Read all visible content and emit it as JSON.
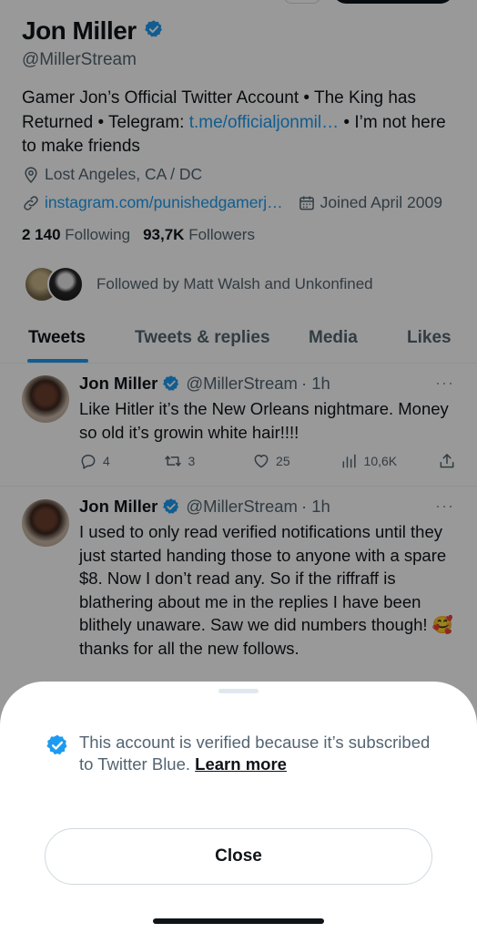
{
  "profile": {
    "name": "Jon Miller",
    "handle": "@MillerStream",
    "bio_part1": "Gamer Jon’s Official Twitter Account • The King has Returned • Telegram: ",
    "bio_link": "t.me/officialjonmil…",
    "bio_part2": " • I’m not here to make friends",
    "location": "Lost Angeles, CA / DC",
    "website": "instagram.com/punishedgamerj…",
    "joined": "Joined April 2009",
    "following_count": "2 140",
    "following_label": "Following",
    "followers_count": "93,7K",
    "followers_label": "Followers",
    "followed_by": "Followed by Matt Walsh and Unkonfined"
  },
  "tabs": [
    {
      "label": "Tweets",
      "active": true
    },
    {
      "label": "Tweets & replies",
      "active": false
    },
    {
      "label": "Media",
      "active": false
    },
    {
      "label": "Likes",
      "active": false
    }
  ],
  "tweets": [
    {
      "author": "Jon Miller",
      "handle": "@MillerStream",
      "time": "· 1h",
      "text": "Like Hitler it’s the New Orleans nightmare. Money so old it’s growin white hair!!!!",
      "replies": "4",
      "retweets": "3",
      "likes": "25",
      "views": "10,6K"
    },
    {
      "author": "Jon Miller",
      "handle": "@MillerStream",
      "time": "· 1h",
      "text": "I used to only read verified notifications until they just started handing those to anyone with a spare $8. Now I don’t read any. So if the riffraff is blathering about me in the replies I have been blithely unaware. Saw we did numbers though! 🥰 thanks for all the new follows."
    }
  ],
  "sheet": {
    "message": "This account is verified because it’s subscribed to Twitter Blue. ",
    "learn_more": "Learn more",
    "close_label": "Close"
  },
  "more_label": "···",
  "colors": {
    "accent": "#1d9bf0",
    "text_primary": "#0f1419",
    "text_secondary": "#536471",
    "overlay": "rgba(0,0,0,0.40)"
  },
  "icons": [
    "verified-badge-icon",
    "location-pin-icon",
    "link-icon",
    "calendar-icon",
    "reply-icon",
    "retweet-icon",
    "like-icon",
    "views-icon",
    "share-icon"
  ]
}
